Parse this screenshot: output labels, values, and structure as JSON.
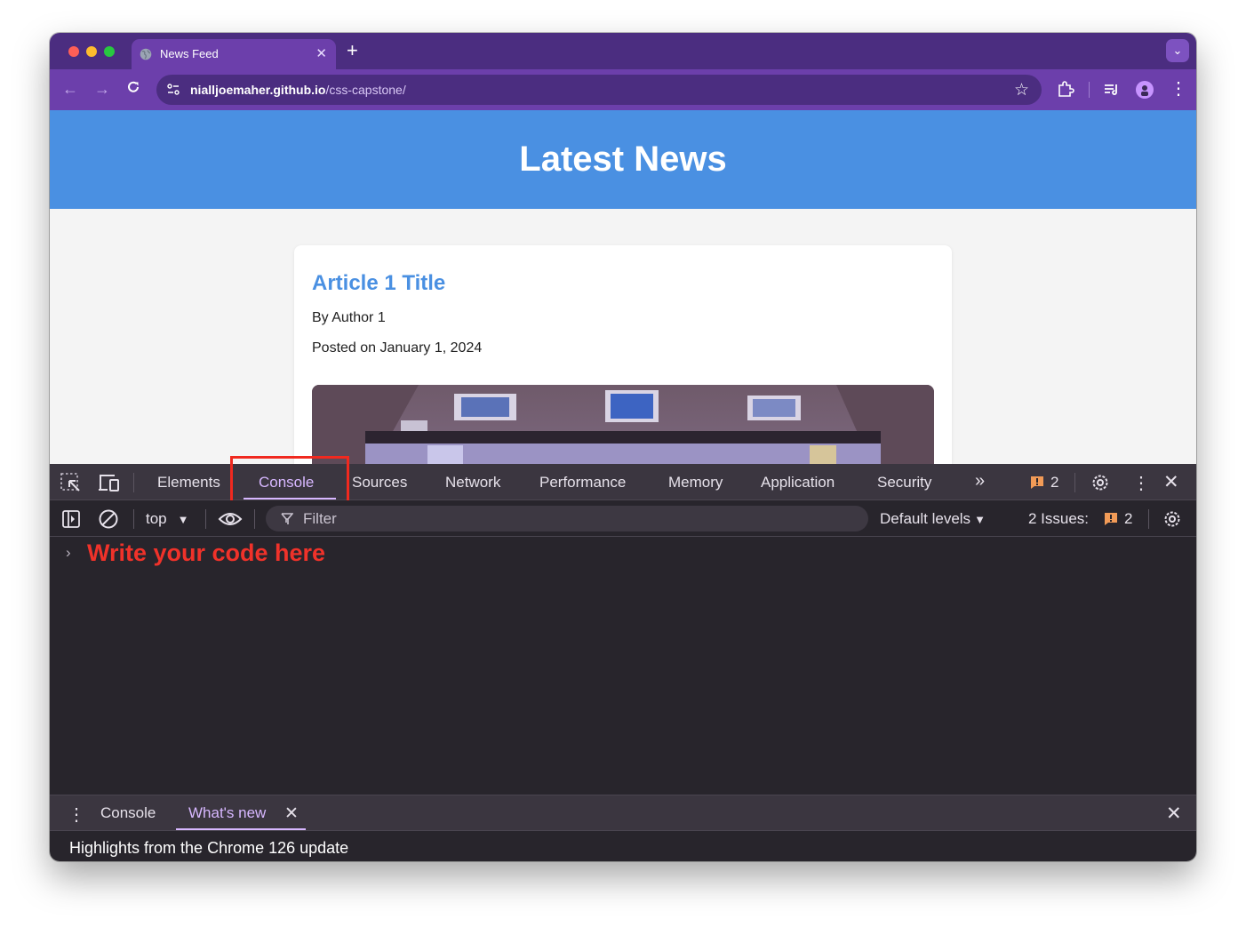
{
  "browser": {
    "tab_title": "News Feed",
    "url_host": "nialljoemaher.github.io",
    "url_path": "/css-capstone/"
  },
  "page": {
    "header": "Latest News",
    "article": {
      "title": "Article 1 Title",
      "author": "By Author 1",
      "date": "Posted on January 1, 2024"
    }
  },
  "devtools": {
    "tabs": [
      "Elements",
      "Console",
      "Sources",
      "Network",
      "Performance",
      "Memory",
      "Application",
      "Security"
    ],
    "active_tab": "Console",
    "issues_badge_count": "2",
    "context": "top",
    "filter_placeholder": "Filter",
    "levels_label": "Default levels",
    "issues_label": "2 Issues:",
    "issues_count": "2",
    "console_hint": "Write your code here",
    "drawer_tabs": [
      "Console",
      "What's new"
    ],
    "whats_new_heading": "Highlights from the Chrome 126 update"
  },
  "colors": {
    "accent_header": "#4a90e2",
    "browser_frame": "#6c3fab",
    "highlight_box": "#f0291f",
    "console_hint": "#f0322a",
    "devtools_accent": "#d7b7ff"
  }
}
